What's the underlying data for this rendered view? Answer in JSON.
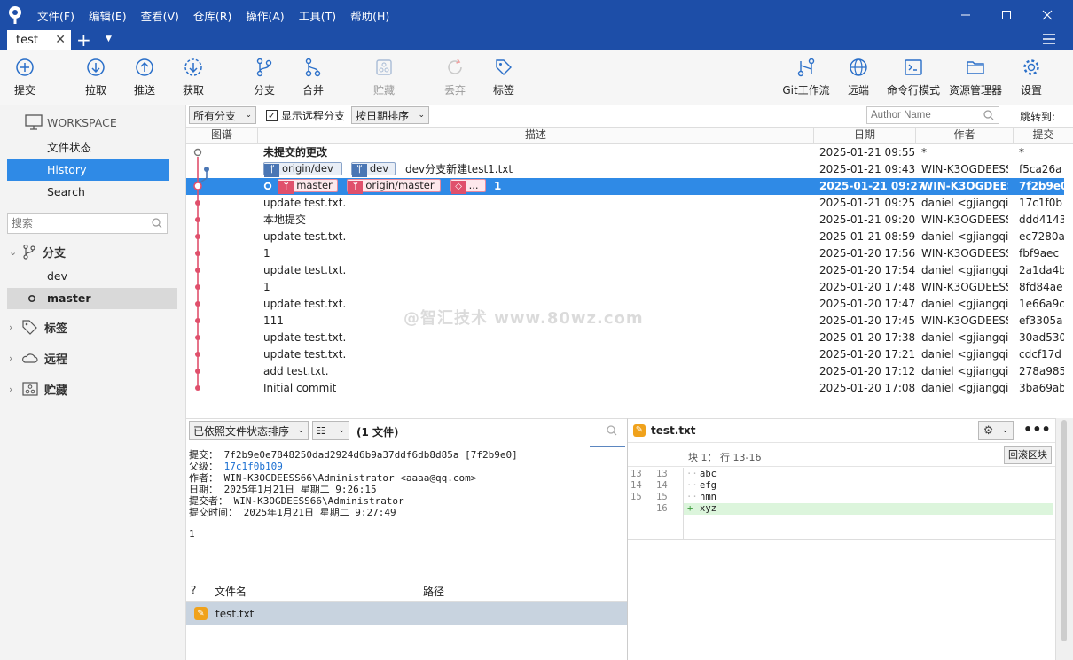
{
  "menu": [
    "文件(F)",
    "编辑(E)",
    "查看(V)",
    "仓库(R)",
    "操作(A)",
    "工具(T)",
    "帮助(H)"
  ],
  "tab": {
    "label": "test"
  },
  "toolbar": {
    "commit": "提交",
    "pull": "拉取",
    "push": "推送",
    "fetch": "获取",
    "branch": "分支",
    "merge": "合并",
    "stash": "贮藏",
    "discard": "丢弃",
    "tag": "标签",
    "gitflow": "Git工作流",
    "remote": "远端",
    "terminal": "命令行模式",
    "explorer": "资源管理器",
    "settings": "设置"
  },
  "sidebar": {
    "workspace": "WORKSPACE",
    "items": [
      "文件状态",
      "History",
      "Search"
    ],
    "search_placeholder": "搜索",
    "branches_label": "分支",
    "branches": [
      "dev",
      "master"
    ],
    "tags_label": "标签",
    "remotes_label": "远程",
    "stashes_label": "贮藏"
  },
  "filter": {
    "all_branches": "所有分支",
    "show_remote": "显示远程分支",
    "sort": "按日期排序",
    "author_placeholder": "Author Name",
    "jump_to": "跳转到:"
  },
  "columns": [
    "图谱",
    "描述",
    "日期",
    "作者",
    "提交"
  ],
  "commits": [
    {
      "desc": "未提交的更改",
      "date": "2025-01-21 09:55",
      "author": "*",
      "hash": "*"
    },
    {
      "desc": "dev分支新建test1.txt",
      "date": "2025-01-21 09:43",
      "author": "WIN-K3OGDEESS",
      "hash": "f5ca26a",
      "refs": [
        "origin/dev",
        "dev"
      ]
    },
    {
      "desc": "1",
      "date": "2025-01-21 09:27",
      "author": "WIN-K3OGDEESS",
      "hash": "7f2b9e0",
      "refs": [
        "master",
        "origin/master",
        "..."
      ]
    },
    {
      "desc": "update test.txt.",
      "date": "2025-01-21 09:25",
      "author": "daniel <gjiangqin",
      "hash": "17c1f0b"
    },
    {
      "desc": "本地提交",
      "date": "2025-01-21 09:20",
      "author": "WIN-K3OGDEESS",
      "hash": "ddd4143"
    },
    {
      "desc": "update test.txt.",
      "date": "2025-01-21 08:59",
      "author": "daniel <gjiangqin",
      "hash": "ec7280a"
    },
    {
      "desc": "1",
      "date": "2025-01-20 17:56",
      "author": "WIN-K3OGDEESS",
      "hash": "fbf9aec"
    },
    {
      "desc": "update test.txt.",
      "date": "2025-01-20 17:54",
      "author": "daniel <gjiangqin",
      "hash": "2a1da4b"
    },
    {
      "desc": "1",
      "date": "2025-01-20 17:48",
      "author": "WIN-K3OGDEESS",
      "hash": "8fd84ae"
    },
    {
      "desc": "update test.txt.",
      "date": "2025-01-20 17:47",
      "author": "daniel <gjiangqin",
      "hash": "1e66a9c"
    },
    {
      "desc": "111",
      "date": "2025-01-20 17:45",
      "author": "WIN-K3OGDEESS",
      "hash": "ef3305a"
    },
    {
      "desc": "update test.txt.",
      "date": "2025-01-20 17:38",
      "author": "daniel <gjiangqin",
      "hash": "30ad530"
    },
    {
      "desc": "update test.txt.",
      "date": "2025-01-20 17:21",
      "author": "daniel <gjiangqin",
      "hash": "cdcf17d"
    },
    {
      "desc": "add test.txt.",
      "date": "2025-01-20 17:12",
      "author": "daniel <gjiangqin",
      "hash": "278a985"
    },
    {
      "desc": "Initial commit",
      "date": "2025-01-20 17:08",
      "author": "daniel <gjiangqin",
      "hash": "3ba69ab"
    }
  ],
  "watermark": "@智汇技术 www.80wz.com",
  "files_panel": {
    "sort": "已依照文件状态排序",
    "count": "(1 文件)",
    "col_q": "?",
    "col_name": "文件名",
    "col_path": "路径",
    "file": "test.txt"
  },
  "commit_info": {
    "commit_label": "提交：",
    "commit": "7f2b9e0e7848250dad2924d6b9a37ddf6db8d85a [7f2b9e0]",
    "parent_label": "父级：",
    "parent": "17c1f0b109",
    "author_label": "作者：",
    "author": "WIN-K3OGDEESS66\\Administrator <aaaa@qq.com>",
    "date_label": "日期：",
    "date": "2025年1月21日 星期二 9:26:15",
    "committer_label": "提交者：",
    "committer": "WIN-K3OGDEESS66\\Administrator",
    "commit_time_label": "提交时间：",
    "commit_time": "2025年1月21日 星期二 9:27:49",
    "message": "1"
  },
  "diff": {
    "filename": "test.txt",
    "hunk": "块 1： 行 13-16",
    "rollback": "回滚区块",
    "lines": [
      {
        "old": "13",
        "new": "13",
        "text": "abc",
        "added": false
      },
      {
        "old": "14",
        "new": "14",
        "text": "efg",
        "added": false
      },
      {
        "old": "15",
        "new": "15",
        "text": "hmn",
        "added": false
      },
      {
        "old": "",
        "new": "16",
        "text": "xyz",
        "added": true
      }
    ]
  }
}
